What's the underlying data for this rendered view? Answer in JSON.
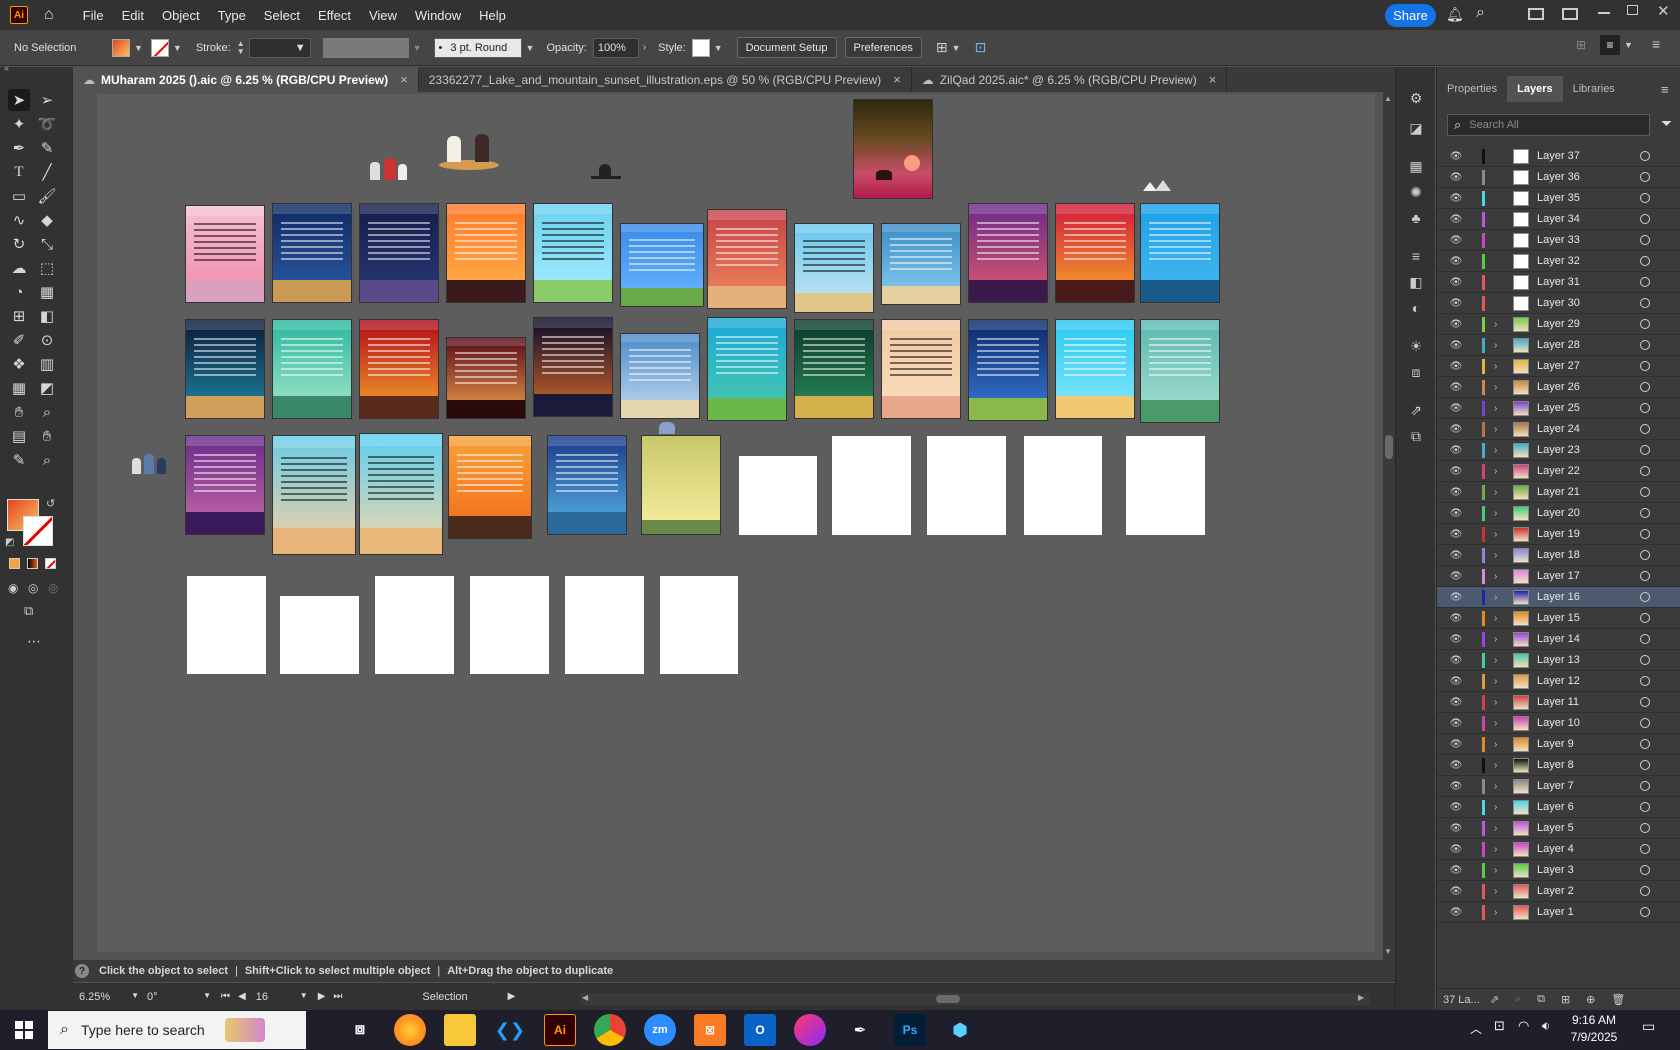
{
  "app": {
    "logo": "Ai"
  },
  "menu": [
    "File",
    "Edit",
    "Object",
    "Type",
    "Select",
    "Effect",
    "View",
    "Window",
    "Help"
  ],
  "share_label": "Share",
  "control": {
    "selection": "No Selection",
    "stroke_label": "Stroke:",
    "brush": "3 pt. Round",
    "opacity_label": "Opacity:",
    "opacity": "100%",
    "style_label": "Style:",
    "document_setup": "Document Setup",
    "preferences": "Preferences"
  },
  "tabs": [
    {
      "label": "MUharam 2025 ().aic @ 6.25 % (RGB/CPU Preview)",
      "active": true
    },
    {
      "label": "23362277_Lake_and_mountain_sunset_illustration.eps @ 50 % (RGB/CPU Preview)",
      "active": false
    },
    {
      "label": "ZilQad 2025.aic* @ 6.25 % (RGB/CPU Preview)",
      "active": false
    }
  ],
  "tab_close": "×",
  "hint": {
    "part1": "Click the object to select",
    "part2": "Shift+Click to select multiple object",
    "part3": "Alt+Drag the object to duplicate",
    "sep": "|"
  },
  "status": {
    "zoom": "6.25%",
    "rotation": "0°",
    "artboard": "16",
    "tool": "Selection"
  },
  "panel": {
    "tabs": [
      "Properties",
      "Layers",
      "Libraries"
    ],
    "active_tab": "Layers",
    "search_placeholder": "Search All",
    "footer_count": "37 La...",
    "selected_layer": "Layer 16",
    "layers": [
      {
        "name": "Layer 37",
        "color": "#111111",
        "expandable": false
      },
      {
        "name": "Layer 36",
        "color": "#8a8a8a",
        "expandable": false
      },
      {
        "name": "Layer 35",
        "color": "#4fd6e8",
        "expandable": false
      },
      {
        "name": "Layer 34",
        "color": "#c255e0",
        "expandable": false
      },
      {
        "name": "Layer 33",
        "color": "#cc44cc",
        "expandable": false
      },
      {
        "name": "Layer 32",
        "color": "#55cc44",
        "expandable": false
      },
      {
        "name": "Layer 31",
        "color": "#e05a5a",
        "expandable": false
      },
      {
        "name": "Layer 30",
        "color": "#e05a5a",
        "expandable": false
      },
      {
        "name": "Layer 29",
        "color": "#7acc44",
        "expandable": true
      },
      {
        "name": "Layer 28",
        "color": "#44aacc",
        "expandable": true
      },
      {
        "name": "Layer 27",
        "color": "#e0b444",
        "expandable": true
      },
      {
        "name": "Layer 26",
        "color": "#cc8844",
        "expandable": true
      },
      {
        "name": "Layer 25",
        "color": "#7744cc",
        "expandable": true
      },
      {
        "name": "Layer 24",
        "color": "#b07744",
        "expandable": true
      },
      {
        "name": "Layer 23",
        "color": "#44b0cc",
        "expandable": true
      },
      {
        "name": "Layer 22",
        "color": "#cc4477",
        "expandable": true
      },
      {
        "name": "Layer 21",
        "color": "#77aa44",
        "expandable": true
      },
      {
        "name": "Layer 20",
        "color": "#44cc77",
        "expandable": true
      },
      {
        "name": "Layer 19",
        "color": "#cc3333",
        "expandable": true
      },
      {
        "name": "Layer 18",
        "color": "#8888dd",
        "expandable": true
      },
      {
        "name": "Layer 17",
        "color": "#dd88dd",
        "expandable": true
      },
      {
        "name": "Layer 16",
        "color": "#2222aa",
        "expandable": true
      },
      {
        "name": "Layer 15",
        "color": "#e08a22",
        "expandable": true
      },
      {
        "name": "Layer 14",
        "color": "#9944dd",
        "expandable": true
      },
      {
        "name": "Layer 13",
        "color": "#44cc99",
        "expandable": true
      },
      {
        "name": "Layer 12",
        "color": "#dd9944",
        "expandable": true
      },
      {
        "name": "Layer 11",
        "color": "#cc4444",
        "expandable": true
      },
      {
        "name": "Layer 10",
        "color": "#cc44aa",
        "expandable": true
      },
      {
        "name": "Layer 9",
        "color": "#e0882a",
        "expandable": true
      },
      {
        "name": "Layer 8",
        "color": "#111111",
        "expandable": true
      },
      {
        "name": "Layer 7",
        "color": "#8a8a8a",
        "expandable": true
      },
      {
        "name": "Layer 6",
        "color": "#4fd6e8",
        "expandable": true
      },
      {
        "name": "Layer 5",
        "color": "#c255e0",
        "expandable": true
      },
      {
        "name": "Layer 4",
        "color": "#cc44cc",
        "expandable": true
      },
      {
        "name": "Layer 3",
        "color": "#55cc44",
        "expandable": true
      },
      {
        "name": "Layer 2",
        "color": "#e05a5a",
        "expandable": true
      },
      {
        "name": "Layer 1",
        "color": "#e05a5a",
        "expandable": true
      }
    ]
  },
  "taskbar": {
    "search_placeholder": "Type here to search",
    "time": "9:16 AM",
    "date": "7/9/2025"
  }
}
